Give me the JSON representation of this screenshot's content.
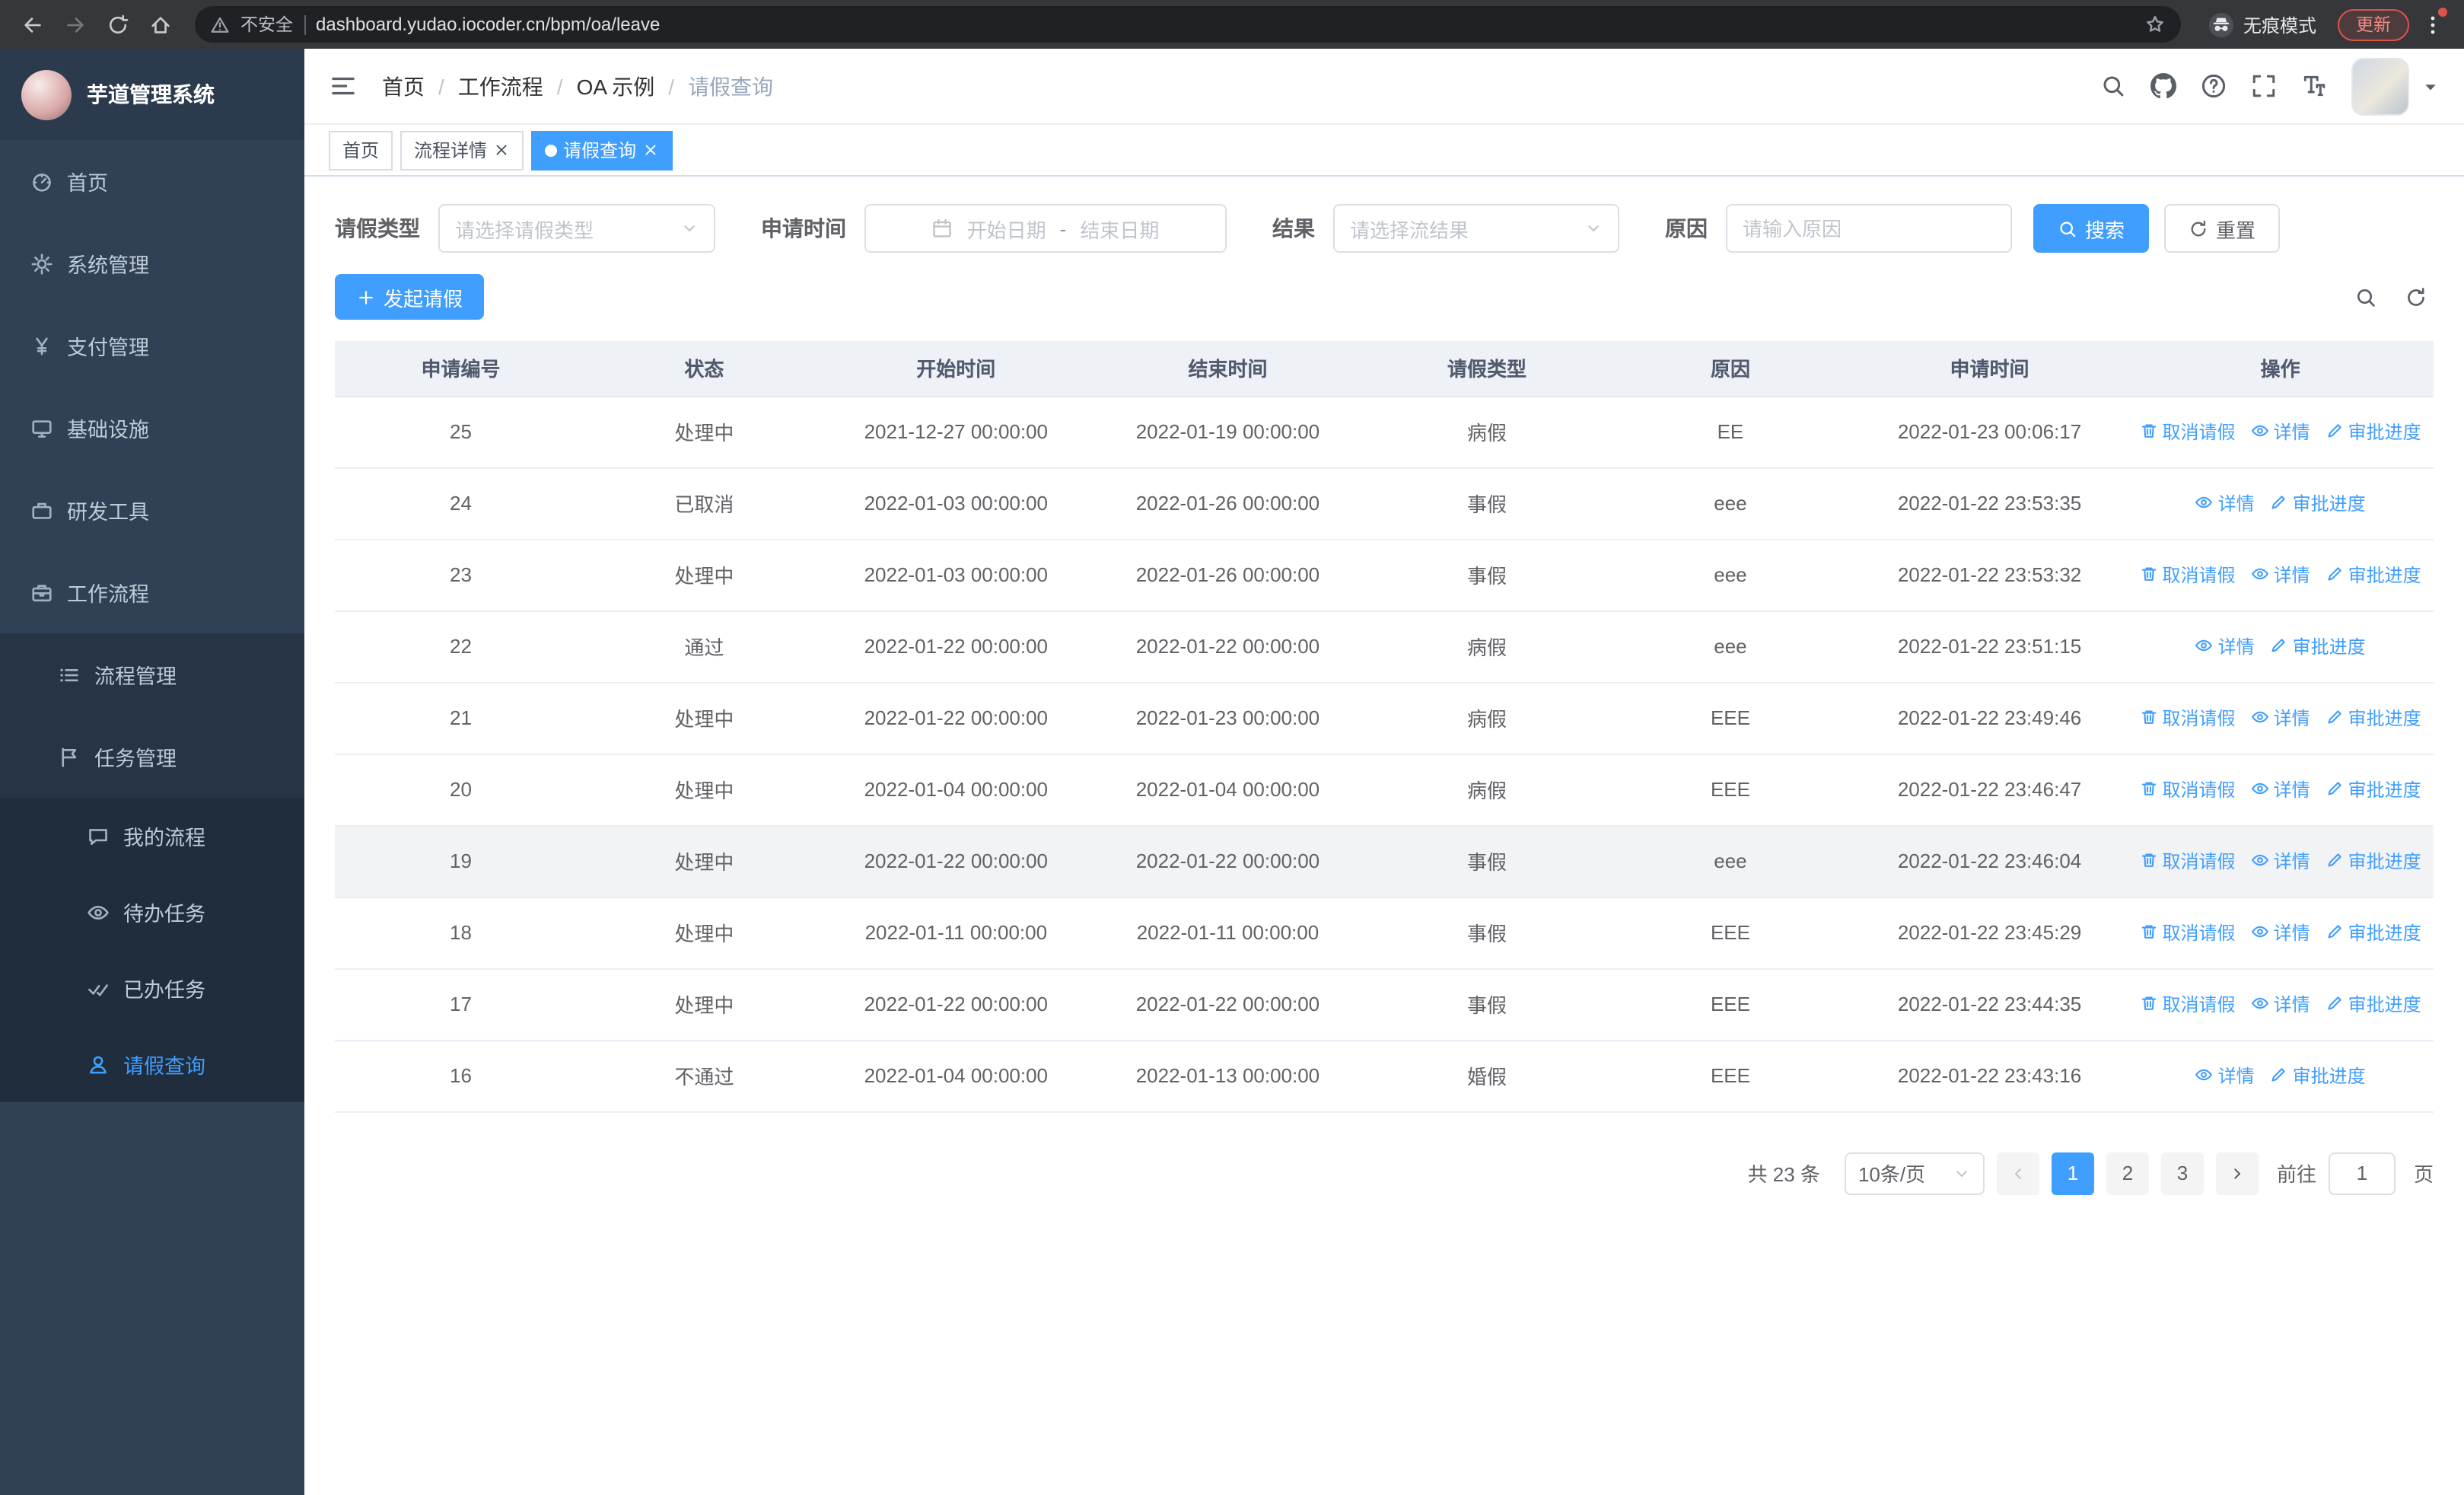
{
  "browser": {
    "security_label": "不安全",
    "url": "dashboard.yudao.iocoder.cn/bpm/oa/leave",
    "incognito_label": "无痕模式",
    "update_label": "更新"
  },
  "sidebar": {
    "logo_title": "芋道管理系统",
    "items": [
      {
        "key": "home",
        "label": "首页",
        "icon": "dashboard-icon",
        "level": 1,
        "arrow": null,
        "active": false
      },
      {
        "key": "system",
        "label": "系统管理",
        "icon": "gear-icon",
        "level": 1,
        "arrow": "down",
        "active": false
      },
      {
        "key": "payment",
        "label": "支付管理",
        "icon": "yen-icon",
        "level": 1,
        "arrow": "down",
        "active": false
      },
      {
        "key": "infra",
        "label": "基础设施",
        "icon": "monitor-icon",
        "level": 1,
        "arrow": "down",
        "active": false
      },
      {
        "key": "devtools",
        "label": "研发工具",
        "icon": "toolbox-icon",
        "level": 1,
        "arrow": "down",
        "active": false
      },
      {
        "key": "workflow",
        "label": "工作流程",
        "icon": "briefcase-icon",
        "level": 1,
        "arrow": "up",
        "active": false
      },
      {
        "key": "process-mgmt",
        "label": "流程管理",
        "icon": "list-icon",
        "level": 2,
        "arrow": "down",
        "active": false
      },
      {
        "key": "task-mgmt",
        "label": "任务管理",
        "icon": "flag-icon",
        "level": 2,
        "arrow": "up",
        "active": false
      },
      {
        "key": "my-process",
        "label": "我的流程",
        "icon": "chat-icon",
        "level": 3,
        "arrow": null,
        "active": false
      },
      {
        "key": "todo-tasks",
        "label": "待办任务",
        "icon": "eye-icon",
        "level": 3,
        "arrow": null,
        "active": false
      },
      {
        "key": "done-tasks",
        "label": "已办任务",
        "icon": "check-icon",
        "level": 3,
        "arrow": null,
        "active": false
      },
      {
        "key": "leave-query",
        "label": "请假查询",
        "icon": "user-icon",
        "level": 3,
        "arrow": null,
        "active": true
      }
    ]
  },
  "header": {
    "breadcrumb": [
      "首页",
      "工作流程",
      "OA 示例",
      "请假查询"
    ]
  },
  "tabs": [
    {
      "key": "home",
      "label": "首页",
      "closable": false,
      "active": false
    },
    {
      "key": "process-detail",
      "label": "流程详情",
      "closable": true,
      "active": false
    },
    {
      "key": "leave-query",
      "label": "请假查询",
      "closable": true,
      "active": true
    }
  ],
  "filters": {
    "leave_type_label": "请假类型",
    "leave_type_placeholder": "请选择请假类型",
    "apply_time_label": "申请时间",
    "start_date_placeholder": "开始日期",
    "range_separator": "-",
    "end_date_placeholder": "结束日期",
    "result_label": "结果",
    "result_placeholder": "请选择流结果",
    "reason_label": "原因",
    "reason_placeholder": "请输入原因",
    "search_label": "搜索",
    "reset_label": "重置"
  },
  "toolbar": {
    "create_label": "发起请假"
  },
  "table": {
    "columns": [
      "申请编号",
      "状态",
      "开始时间",
      "结束时间",
      "请假类型",
      "原因",
      "申请时间",
      "操作"
    ],
    "action_labels": {
      "cancel": "取消请假",
      "detail": "详情",
      "progress": "审批进度"
    },
    "rows": [
      {
        "id": "25",
        "status": "处理中",
        "start": "2021-12-27 00:00:00",
        "end": "2022-01-19 00:00:00",
        "type": "病假",
        "reason": "EE",
        "applied": "2022-01-23 00:06:17",
        "actions": [
          "cancel",
          "detail",
          "progress"
        ],
        "highlight": false
      },
      {
        "id": "24",
        "status": "已取消",
        "start": "2022-01-03 00:00:00",
        "end": "2022-01-26 00:00:00",
        "type": "事假",
        "reason": "eee",
        "applied": "2022-01-22 23:53:35",
        "actions": [
          "detail",
          "progress"
        ],
        "highlight": false
      },
      {
        "id": "23",
        "status": "处理中",
        "start": "2022-01-03 00:00:00",
        "end": "2022-01-26 00:00:00",
        "type": "事假",
        "reason": "eee",
        "applied": "2022-01-22 23:53:32",
        "actions": [
          "cancel",
          "detail",
          "progress"
        ],
        "highlight": false
      },
      {
        "id": "22",
        "status": "通过",
        "start": "2022-01-22 00:00:00",
        "end": "2022-01-22 00:00:00",
        "type": "病假",
        "reason": "eee",
        "applied": "2022-01-22 23:51:15",
        "actions": [
          "detail",
          "progress"
        ],
        "highlight": false
      },
      {
        "id": "21",
        "status": "处理中",
        "start": "2022-01-22 00:00:00",
        "end": "2022-01-23 00:00:00",
        "type": "病假",
        "reason": "EEE",
        "applied": "2022-01-22 23:49:46",
        "actions": [
          "cancel",
          "detail",
          "progress"
        ],
        "highlight": false
      },
      {
        "id": "20",
        "status": "处理中",
        "start": "2022-01-04 00:00:00",
        "end": "2022-01-04 00:00:00",
        "type": "病假",
        "reason": "EEE",
        "applied": "2022-01-22 23:46:47",
        "actions": [
          "cancel",
          "detail",
          "progress"
        ],
        "highlight": false
      },
      {
        "id": "19",
        "status": "处理中",
        "start": "2022-01-22 00:00:00",
        "end": "2022-01-22 00:00:00",
        "type": "事假",
        "reason": "eee",
        "applied": "2022-01-22 23:46:04",
        "actions": [
          "cancel",
          "detail",
          "progress"
        ],
        "highlight": true
      },
      {
        "id": "18",
        "status": "处理中",
        "start": "2022-01-11 00:00:00",
        "end": "2022-01-11 00:00:00",
        "type": "事假",
        "reason": "EEE",
        "applied": "2022-01-22 23:45:29",
        "actions": [
          "cancel",
          "detail",
          "progress"
        ],
        "highlight": false
      },
      {
        "id": "17",
        "status": "处理中",
        "start": "2022-01-22 00:00:00",
        "end": "2022-01-22 00:00:00",
        "type": "事假",
        "reason": "EEE",
        "applied": "2022-01-22 23:44:35",
        "actions": [
          "cancel",
          "detail",
          "progress"
        ],
        "highlight": false
      },
      {
        "id": "16",
        "status": "不通过",
        "start": "2022-01-04 00:00:00",
        "end": "2022-01-13 00:00:00",
        "type": "婚假",
        "reason": "EEE",
        "applied": "2022-01-22 23:43:16",
        "actions": [
          "detail",
          "progress"
        ],
        "highlight": false
      }
    ]
  },
  "pagination": {
    "total_label": "共 23 条",
    "page_size_label": "10条/页",
    "pages": [
      "1",
      "2",
      "3"
    ],
    "active_page": "1",
    "goto_label": "前往",
    "goto_value": "1",
    "page_suffix": "页"
  }
}
